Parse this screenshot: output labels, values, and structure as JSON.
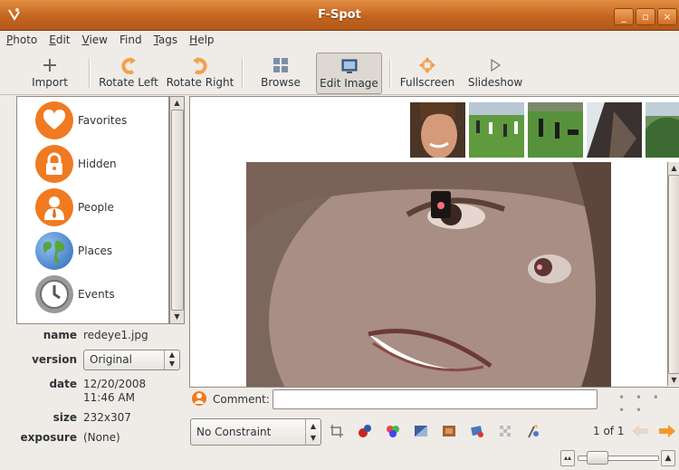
{
  "window": {
    "title": "F-Spot",
    "buttons": [
      "_",
      "▫",
      "×"
    ]
  },
  "menubar": [
    {
      "label": "Photo",
      "mnemonic": "P",
      "rest": "hoto"
    },
    {
      "label": "Edit",
      "mnemonic": "E",
      "rest": "dit"
    },
    {
      "label": "View",
      "mnemonic": "V",
      "rest": "iew"
    },
    {
      "label": "Find",
      "mnemonic": "",
      "rest": "Find"
    },
    {
      "label": "Tags",
      "mnemonic": "T",
      "rest": "ags"
    },
    {
      "label": "Help",
      "mnemonic": "H",
      "rest": "elp"
    }
  ],
  "toolbar": {
    "import": "Import",
    "rotate_left": "Rotate Left",
    "rotate_right": "Rotate Right",
    "browse": "Browse",
    "edit_image": "Edit Image",
    "fullscreen": "Fullscreen",
    "slideshow": "Slideshow"
  },
  "tags": [
    {
      "label": "Favorites",
      "icon": "heart-icon",
      "color": "#f07a20"
    },
    {
      "label": "Hidden",
      "icon": "lock-icon",
      "color": "#f07a20"
    },
    {
      "label": "People",
      "icon": "person-icon",
      "color": "#f07a20"
    },
    {
      "label": "Places",
      "icon": "globe-icon",
      "color": "#3a78c8"
    },
    {
      "label": "Events",
      "icon": "clock-icon",
      "color": "#8a8a8a"
    }
  ],
  "properties": {
    "name_label": "name",
    "name_value": "redeye1.jpg",
    "version_label": "version",
    "version_value": "Original",
    "date_label": "date",
    "date_value": "12/20/2008",
    "time_value": "11:46 AM",
    "size_label": "size",
    "size_value": "232x307",
    "exposure_label": "exposure",
    "exposure_value": "(None)"
  },
  "comment": {
    "label": "Comment:",
    "value": ""
  },
  "edit_bar": {
    "constraint": "No Constraint",
    "page_count": "1 of 1"
  },
  "colors": {
    "accent": "#d8711f",
    "active_button": "#ddd8d2"
  }
}
